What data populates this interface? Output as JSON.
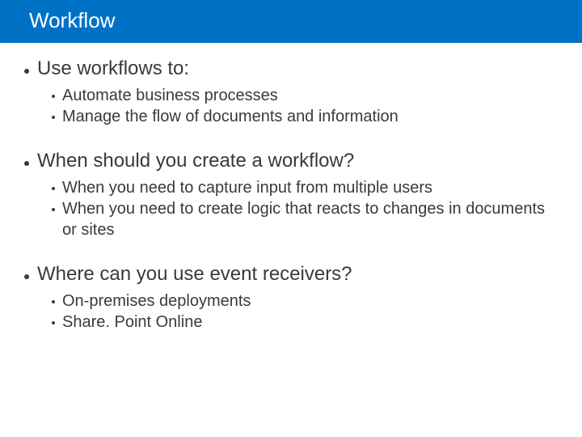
{
  "header": {
    "title": "Workflow"
  },
  "sections": [
    {
      "title": "Use workflows to:",
      "items": [
        "Automate business processes",
        "Manage the flow of documents and information"
      ]
    },
    {
      "title": "When should you create a workflow?",
      "items": [
        "When you need to capture input from multiple users",
        "When you need to create logic that reacts to changes in documents or sites"
      ]
    },
    {
      "title": "Where can you use event receivers?",
      "items": [
        "On-premises deployments",
        "Share. Point Online"
      ]
    }
  ]
}
